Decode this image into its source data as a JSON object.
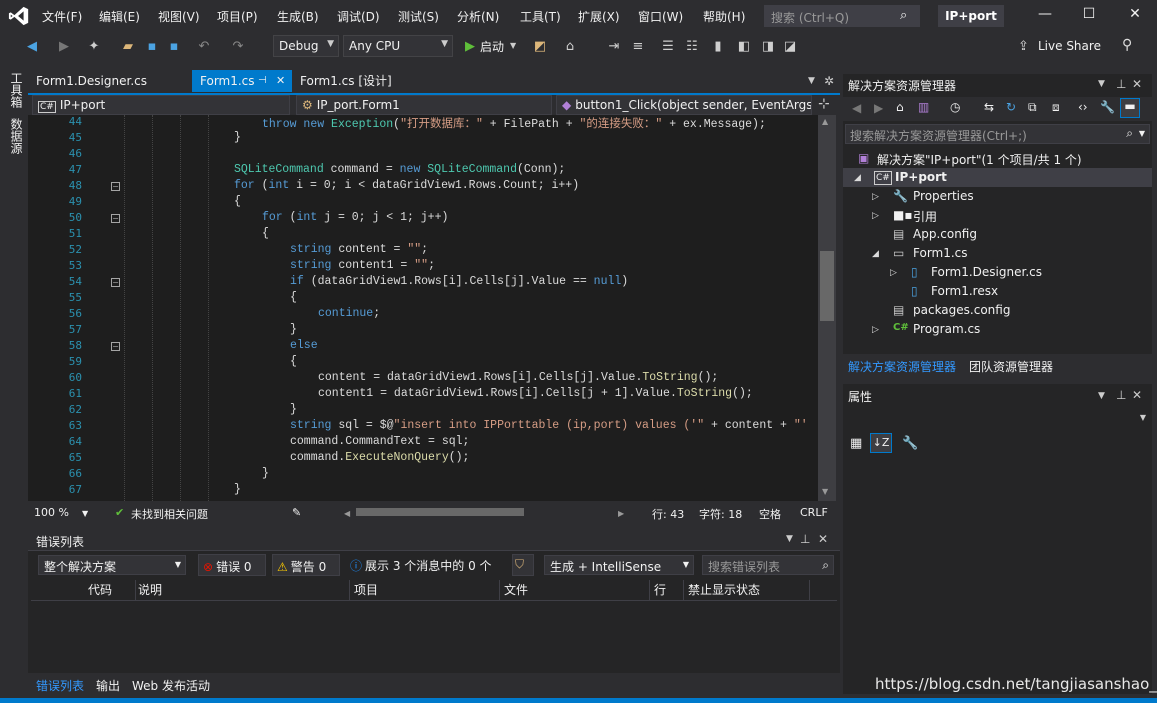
{
  "menu": [
    "文件(F)",
    "编辑(E)",
    "视图(V)",
    "项目(P)",
    "生成(B)",
    "调试(D)",
    "测试(S)",
    "分析(N)",
    "工具(T)",
    "扩展(X)",
    "窗口(W)",
    "帮助(H)"
  ],
  "search": {
    "placeholder": "搜索 (Ctrl+Q)"
  },
  "solution_title": "IP+port",
  "toolbar": {
    "config": "Debug",
    "platform": "Any CPU",
    "start": "启动",
    "live_share": "Live Share"
  },
  "left_strip": [
    "工具箱",
    "数据源"
  ],
  "tabs": [
    {
      "label": "Form1.Designer.cs",
      "active": false
    },
    {
      "label": "Form1.cs",
      "active": true,
      "pin": "⊣"
    },
    {
      "label": "Form1.cs [设计]",
      "active": false
    }
  ],
  "nav": {
    "project": "IP+port",
    "class": "IP_port.Form1",
    "member": "button1_Click(object sender, EventArgs"
  },
  "code_lines": [
    {
      "n": "44",
      "text": "throw new Exception(\"打开数据库：\" + FilePath + \"的连接失败：\" + ex.Message);",
      "indent": 4
    },
    {
      "n": "45",
      "text": "}",
      "indent": 3
    },
    {
      "n": "46",
      "text": "",
      "indent": 0
    },
    {
      "n": "47",
      "text": "SQLiteCommand command = new SQLiteCommand(Conn);",
      "indent": 3
    },
    {
      "n": "48",
      "text": "for (int i = 0; i < dataGridView1.Rows.Count; i++)",
      "indent": 3
    },
    {
      "n": "49",
      "text": "{",
      "indent": 3
    },
    {
      "n": "50",
      "text": "for (int j = 0; j < 1; j++)",
      "indent": 4
    },
    {
      "n": "51",
      "text": "{",
      "indent": 4
    },
    {
      "n": "52",
      "text": "string content = \"\";",
      "indent": 5
    },
    {
      "n": "53",
      "text": "string content1 = \"\";",
      "indent": 5
    },
    {
      "n": "54",
      "text": "if (dataGridView1.Rows[i].Cells[j].Value == null)",
      "indent": 5
    },
    {
      "n": "55",
      "text": "{",
      "indent": 5
    },
    {
      "n": "56",
      "text": "continue;",
      "indent": 6
    },
    {
      "n": "57",
      "text": "}",
      "indent": 5
    },
    {
      "n": "58",
      "text": "else",
      "indent": 5
    },
    {
      "n": "59",
      "text": "{",
      "indent": 5
    },
    {
      "n": "60",
      "text": "content = dataGridView1.Rows[i].Cells[j].Value.ToString();",
      "indent": 6
    },
    {
      "n": "61",
      "text": "content1 = dataGridView1.Rows[i].Cells[j + 1].Value.ToString();",
      "indent": 6
    },
    {
      "n": "62",
      "text": "}",
      "indent": 5
    },
    {
      "n": "63",
      "text": "string sql = $@\"insert into IPPorttable (ip,port) values ('\" + content + \"'",
      "indent": 5
    },
    {
      "n": "64",
      "text": "command.CommandText = sql;",
      "indent": 5
    },
    {
      "n": "65",
      "text": "command.ExecuteNonQuery();",
      "indent": 5
    },
    {
      "n": "66",
      "text": "}",
      "indent": 4
    },
    {
      "n": "67",
      "text": "}",
      "indent": 3
    }
  ],
  "status": {
    "zoom": "100 %",
    "issues": "未找到相关问题",
    "line": "行: 43",
    "char": "字符: 18",
    "spaces": "空格",
    "eol": "CRLF"
  },
  "error_list": {
    "title": "错误列表",
    "scope": "整个解决方案",
    "errors": "错误 0",
    "warnings": "警告 0",
    "messages": "展示 3 个消息中的 0 个",
    "build": "生成 + IntelliSense",
    "search_placeholder": "搜索错误列表",
    "columns": [
      "代码",
      "说明",
      "项目",
      "文件",
      "行",
      "禁止显示状态"
    ]
  },
  "bottom_tabs": [
    "错误列表",
    "输出",
    "Web 发布活动"
  ],
  "solution_explorer": {
    "title": "解决方案资源管理器",
    "search_placeholder": "搜索解决方案资源管理器(Ctrl+;)",
    "root": "解决方案\"IP+port\"(1 个项目/共 1 个)",
    "project": "IP+port",
    "items": [
      "Properties",
      "引用",
      "App.config",
      "Form1.cs",
      "Form1.Designer.cs",
      "Form1.resx",
      "packages.config",
      "Program.cs"
    ],
    "tab_active": "解决方案资源管理器",
    "tab_other": "团队资源管理器"
  },
  "properties": {
    "title": "属性"
  },
  "watermark": "https://blog.csdn.net/tangjiasanshao__",
  "colors": {
    "accent": "#007acc",
    "keyword": "#569cd6",
    "type": "#4ec9b0",
    "string": "#d69d85"
  }
}
